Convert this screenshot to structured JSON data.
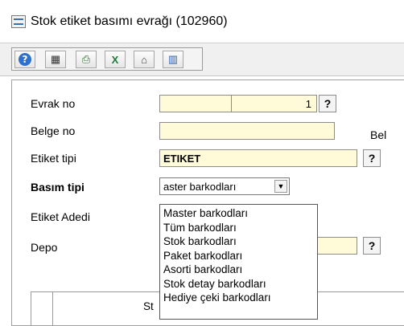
{
  "window": {
    "title": "Stok etiket basımı evrağı (102960)"
  },
  "toolbar": {
    "buttons": [
      {
        "icon": "help-icon",
        "glyph": "?"
      },
      {
        "icon": "calculator-icon",
        "glyph": "▦"
      },
      {
        "icon": "print-icon",
        "glyph": "⎙"
      },
      {
        "icon": "excel-icon",
        "glyph": "X"
      },
      {
        "icon": "home-icon",
        "glyph": "⌂"
      },
      {
        "icon": "barcode-icon",
        "glyph": "▥"
      }
    ]
  },
  "form": {
    "evrak_no": {
      "label": "Evrak no",
      "value": "1"
    },
    "belge_no": {
      "label": "Belge no",
      "value": ""
    },
    "belge_right_label": "Bel",
    "etiket_tipi": {
      "label": "Etiket tipi",
      "value": "ETIKET"
    },
    "basim_tipi": {
      "label": "Basım tipi",
      "value": "aster barkodları"
    },
    "etiket_adedi": {
      "label": "Etiket Adedi"
    },
    "depo": {
      "label": "Depo",
      "value": ""
    },
    "lookup_glyph": "?",
    "combo_arrow": "▼"
  },
  "dropdown": {
    "options": [
      "Master barkodları",
      "Tüm barkodları",
      "Stok barkodları",
      "Paket barkodları",
      "Asorti barkodları",
      "Stok detay barkodları",
      "Hediye çeki barkodları"
    ]
  },
  "grid": {
    "header_partial": "St"
  }
}
